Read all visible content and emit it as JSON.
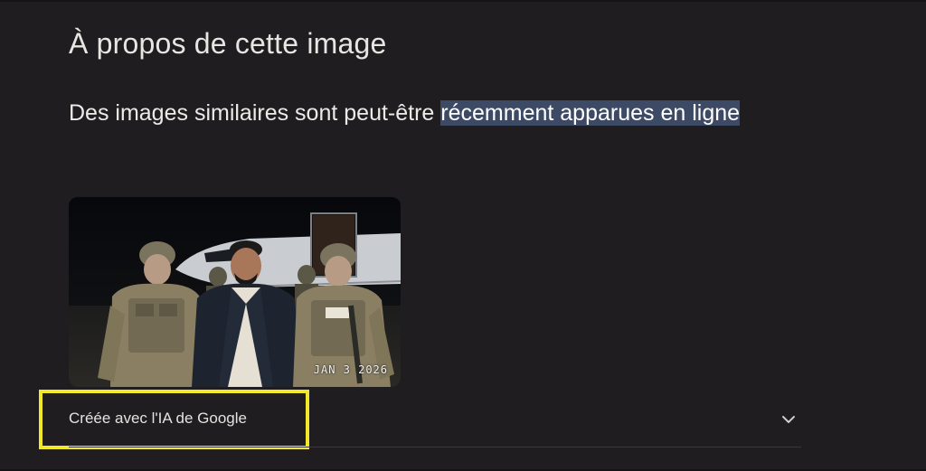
{
  "panel": {
    "title": "À propos de cette image",
    "description_before": "Des images similaires sont peut-être ",
    "description_highlight": "récemment apparues en ligne"
  },
  "image": {
    "date_stamp": "JAN 3 2026"
  },
  "footer": {
    "credit_label": "Créée avec l'IA de Google",
    "expand_icon": "chevron-down-icon"
  },
  "colors": {
    "background": "#1f1d1f",
    "highlight": "#3d4a66",
    "annotation_box": "#f2e82a"
  }
}
